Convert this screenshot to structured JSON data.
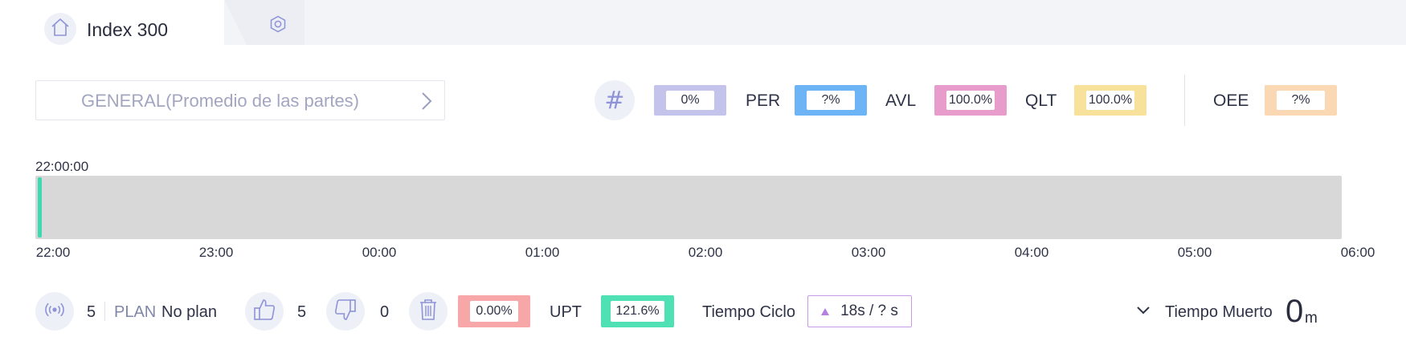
{
  "tab": {
    "title": "Index 300",
    "home_icon": "home-icon",
    "settings_icon": "gear-icon"
  },
  "part_selector": {
    "label": "GENERAL(Promedio de las partes)"
  },
  "kpis": {
    "hash_symbol": "#",
    "count": {
      "value": "0%",
      "color": "#c3c3ec"
    },
    "per": {
      "label": "PER",
      "value": "?%",
      "color": "#6cb4f5"
    },
    "avl": {
      "label": "AVL",
      "value": "100.0%",
      "color": "#e79ccb"
    },
    "qlt": {
      "label": "QLT",
      "value": "100.0%",
      "color": "#f8e19a"
    },
    "oee": {
      "label": "OEE",
      "value": "?%",
      "color": "#fbd8b4"
    }
  },
  "timeline": {
    "current_time": "22:00:00",
    "bar_color": "#d8d8d8",
    "marker_color": "#3ed9ae",
    "ticks": [
      "22:00",
      "23:00",
      "00:00",
      "01:00",
      "02:00",
      "03:00",
      "04:00",
      "05:00",
      "06:00"
    ]
  },
  "bottom": {
    "sensor_count": "5",
    "plan_label": "PLAN",
    "plan_value": "No plan",
    "good_count": "5",
    "bad_count": "0",
    "scrap_percent": {
      "value": "0.00%",
      "color": "#f7a7a7"
    },
    "upt": {
      "label": "UPT",
      "value": "121.6%",
      "color": "#4fe0b4"
    },
    "cycle_time": {
      "label": "Tiempo Ciclo",
      "value": "18s / ? s"
    },
    "dead_time": {
      "label": "Tiempo Muerto",
      "value": "0",
      "unit": "m"
    }
  }
}
